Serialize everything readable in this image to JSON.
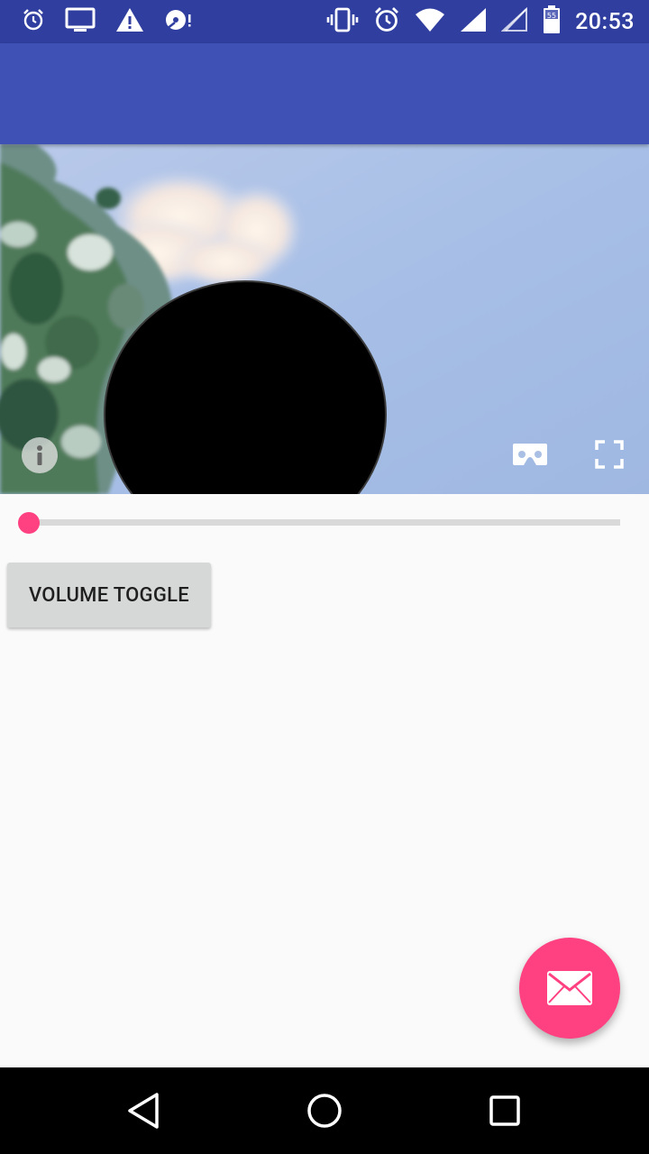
{
  "status_bar": {
    "time": "20:53",
    "battery_level": "55",
    "left_icons": [
      "alarm-icon",
      "cast-screen-icon",
      "warning-icon",
      "disc-sync-icon"
    ],
    "right_icons": [
      "vibrate-icon",
      "alarm-clock-icon",
      "wifi-icon",
      "signal-full-icon",
      "signal-empty-icon",
      "battery-icon"
    ]
  },
  "video_player": {
    "controls": [
      "info-icon",
      "cardboard-vr-icon",
      "fullscreen-icon"
    ],
    "seek_progress_percent": 0
  },
  "volume_button": {
    "label": "VOLUME TOGGLE"
  },
  "fab": {
    "icon": "email-icon"
  },
  "nav_bar": {
    "buttons": [
      "back-icon",
      "home-icon",
      "recents-icon"
    ]
  },
  "colors": {
    "status_bar": "#303f9f",
    "app_bar": "#3f51b5",
    "accent": "#ff4081",
    "background": "#fafafa",
    "button": "#d6d7d7"
  }
}
